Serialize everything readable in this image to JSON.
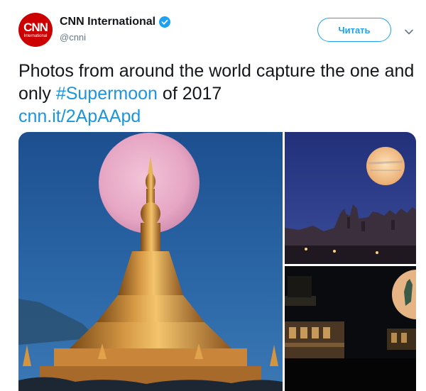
{
  "account": {
    "display_name": "CNN International",
    "handle": "@cnni",
    "avatar_logo_main": "CNN",
    "avatar_logo_sub": "International",
    "verified": true
  },
  "follow_button": {
    "label": "Читать"
  },
  "tweet": {
    "text_part1": "Photos from around the world capture the one and only ",
    "hashtag": "#Supermoon",
    "text_part2": " of 2017",
    "link": "cnn.it/2ApAApd"
  },
  "colors": {
    "brand_blue": "#1da1f2",
    "link_blue": "#1b95e0",
    "cnn_red": "#cc0000",
    "handle_gray": "#657786"
  },
  "media": {
    "photos": [
      {
        "name": "supermoon-pagoda-photo"
      },
      {
        "name": "supermoon-abbey-ruins-photo"
      },
      {
        "name": "supermoon-statue-photo"
      }
    ]
  }
}
